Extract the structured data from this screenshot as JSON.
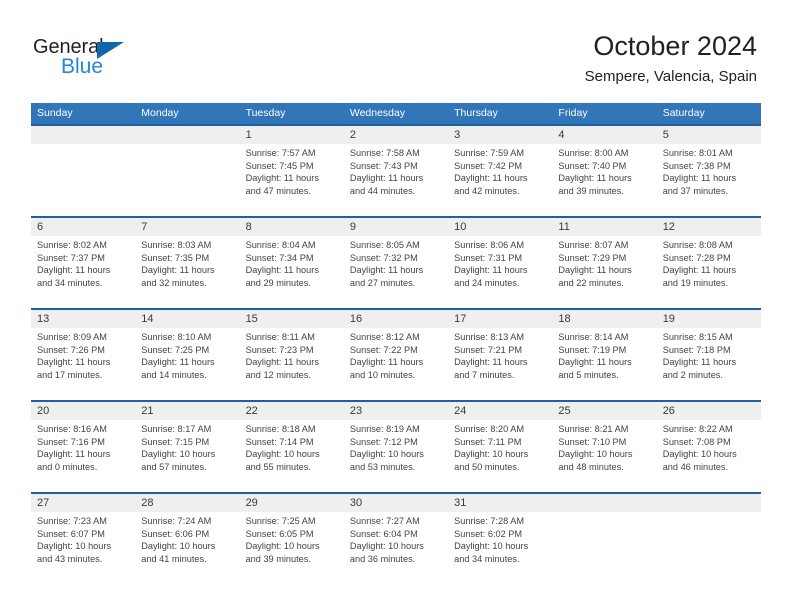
{
  "brand": {
    "name_part1": "General",
    "name_part2": "Blue",
    "triangle_color": "#1266ad",
    "blue_color": "#2388d6"
  },
  "header": {
    "title": "October 2024",
    "subtitle": "Sempere, Valencia, Spain",
    "weekday_header_bg": "#3176b9",
    "row_divider_color": "#21609f",
    "day_band_bg": "#efefef"
  },
  "weekdays": [
    "Sunday",
    "Monday",
    "Tuesday",
    "Wednesday",
    "Thursday",
    "Friday",
    "Saturday"
  ],
  "weeks": [
    [
      {
        "day": "",
        "sunrise": "",
        "sunset": "",
        "daylight1": "",
        "daylight2": "",
        "empty": true
      },
      {
        "day": "",
        "sunrise": "",
        "sunset": "",
        "daylight1": "",
        "daylight2": "",
        "empty": true
      },
      {
        "day": "1",
        "sunrise": "Sunrise: 7:57 AM",
        "sunset": "Sunset: 7:45 PM",
        "daylight1": "Daylight: 11 hours",
        "daylight2": "and 47 minutes."
      },
      {
        "day": "2",
        "sunrise": "Sunrise: 7:58 AM",
        "sunset": "Sunset: 7:43 PM",
        "daylight1": "Daylight: 11 hours",
        "daylight2": "and 44 minutes."
      },
      {
        "day": "3",
        "sunrise": "Sunrise: 7:59 AM",
        "sunset": "Sunset: 7:42 PM",
        "daylight1": "Daylight: 11 hours",
        "daylight2": "and 42 minutes."
      },
      {
        "day": "4",
        "sunrise": "Sunrise: 8:00 AM",
        "sunset": "Sunset: 7:40 PM",
        "daylight1": "Daylight: 11 hours",
        "daylight2": "and 39 minutes."
      },
      {
        "day": "5",
        "sunrise": "Sunrise: 8:01 AM",
        "sunset": "Sunset: 7:38 PM",
        "daylight1": "Daylight: 11 hours",
        "daylight2": "and 37 minutes."
      }
    ],
    [
      {
        "day": "6",
        "sunrise": "Sunrise: 8:02 AM",
        "sunset": "Sunset: 7:37 PM",
        "daylight1": "Daylight: 11 hours",
        "daylight2": "and 34 minutes."
      },
      {
        "day": "7",
        "sunrise": "Sunrise: 8:03 AM",
        "sunset": "Sunset: 7:35 PM",
        "daylight1": "Daylight: 11 hours",
        "daylight2": "and 32 minutes."
      },
      {
        "day": "8",
        "sunrise": "Sunrise: 8:04 AM",
        "sunset": "Sunset: 7:34 PM",
        "daylight1": "Daylight: 11 hours",
        "daylight2": "and 29 minutes."
      },
      {
        "day": "9",
        "sunrise": "Sunrise: 8:05 AM",
        "sunset": "Sunset: 7:32 PM",
        "daylight1": "Daylight: 11 hours",
        "daylight2": "and 27 minutes."
      },
      {
        "day": "10",
        "sunrise": "Sunrise: 8:06 AM",
        "sunset": "Sunset: 7:31 PM",
        "daylight1": "Daylight: 11 hours",
        "daylight2": "and 24 minutes."
      },
      {
        "day": "11",
        "sunrise": "Sunrise: 8:07 AM",
        "sunset": "Sunset: 7:29 PM",
        "daylight1": "Daylight: 11 hours",
        "daylight2": "and 22 minutes."
      },
      {
        "day": "12",
        "sunrise": "Sunrise: 8:08 AM",
        "sunset": "Sunset: 7:28 PM",
        "daylight1": "Daylight: 11 hours",
        "daylight2": "and 19 minutes."
      }
    ],
    [
      {
        "day": "13",
        "sunrise": "Sunrise: 8:09 AM",
        "sunset": "Sunset: 7:26 PM",
        "daylight1": "Daylight: 11 hours",
        "daylight2": "and 17 minutes."
      },
      {
        "day": "14",
        "sunrise": "Sunrise: 8:10 AM",
        "sunset": "Sunset: 7:25 PM",
        "daylight1": "Daylight: 11 hours",
        "daylight2": "and 14 minutes."
      },
      {
        "day": "15",
        "sunrise": "Sunrise: 8:11 AM",
        "sunset": "Sunset: 7:23 PM",
        "daylight1": "Daylight: 11 hours",
        "daylight2": "and 12 minutes."
      },
      {
        "day": "16",
        "sunrise": "Sunrise: 8:12 AM",
        "sunset": "Sunset: 7:22 PM",
        "daylight1": "Daylight: 11 hours",
        "daylight2": "and 10 minutes."
      },
      {
        "day": "17",
        "sunrise": "Sunrise: 8:13 AM",
        "sunset": "Sunset: 7:21 PM",
        "daylight1": "Daylight: 11 hours",
        "daylight2": "and 7 minutes."
      },
      {
        "day": "18",
        "sunrise": "Sunrise: 8:14 AM",
        "sunset": "Sunset: 7:19 PM",
        "daylight1": "Daylight: 11 hours",
        "daylight2": "and 5 minutes."
      },
      {
        "day": "19",
        "sunrise": "Sunrise: 8:15 AM",
        "sunset": "Sunset: 7:18 PM",
        "daylight1": "Daylight: 11 hours",
        "daylight2": "and 2 minutes."
      }
    ],
    [
      {
        "day": "20",
        "sunrise": "Sunrise: 8:16 AM",
        "sunset": "Sunset: 7:16 PM",
        "daylight1": "Daylight: 11 hours",
        "daylight2": "and 0 minutes."
      },
      {
        "day": "21",
        "sunrise": "Sunrise: 8:17 AM",
        "sunset": "Sunset: 7:15 PM",
        "daylight1": "Daylight: 10 hours",
        "daylight2": "and 57 minutes."
      },
      {
        "day": "22",
        "sunrise": "Sunrise: 8:18 AM",
        "sunset": "Sunset: 7:14 PM",
        "daylight1": "Daylight: 10 hours",
        "daylight2": "and 55 minutes."
      },
      {
        "day": "23",
        "sunrise": "Sunrise: 8:19 AM",
        "sunset": "Sunset: 7:12 PM",
        "daylight1": "Daylight: 10 hours",
        "daylight2": "and 53 minutes."
      },
      {
        "day": "24",
        "sunrise": "Sunrise: 8:20 AM",
        "sunset": "Sunset: 7:11 PM",
        "daylight1": "Daylight: 10 hours",
        "daylight2": "and 50 minutes."
      },
      {
        "day": "25",
        "sunrise": "Sunrise: 8:21 AM",
        "sunset": "Sunset: 7:10 PM",
        "daylight1": "Daylight: 10 hours",
        "daylight2": "and 48 minutes."
      },
      {
        "day": "26",
        "sunrise": "Sunrise: 8:22 AM",
        "sunset": "Sunset: 7:08 PM",
        "daylight1": "Daylight: 10 hours",
        "daylight2": "and 46 minutes."
      }
    ],
    [
      {
        "day": "27",
        "sunrise": "Sunrise: 7:23 AM",
        "sunset": "Sunset: 6:07 PM",
        "daylight1": "Daylight: 10 hours",
        "daylight2": "and 43 minutes."
      },
      {
        "day": "28",
        "sunrise": "Sunrise: 7:24 AM",
        "sunset": "Sunset: 6:06 PM",
        "daylight1": "Daylight: 10 hours",
        "daylight2": "and 41 minutes."
      },
      {
        "day": "29",
        "sunrise": "Sunrise: 7:25 AM",
        "sunset": "Sunset: 6:05 PM",
        "daylight1": "Daylight: 10 hours",
        "daylight2": "and 39 minutes."
      },
      {
        "day": "30",
        "sunrise": "Sunrise: 7:27 AM",
        "sunset": "Sunset: 6:04 PM",
        "daylight1": "Daylight: 10 hours",
        "daylight2": "and 36 minutes."
      },
      {
        "day": "31",
        "sunrise": "Sunrise: 7:28 AM",
        "sunset": "Sunset: 6:02 PM",
        "daylight1": "Daylight: 10 hours",
        "daylight2": "and 34 minutes."
      },
      {
        "day": "",
        "sunrise": "",
        "sunset": "",
        "daylight1": "",
        "daylight2": "",
        "empty": true
      },
      {
        "day": "",
        "sunrise": "",
        "sunset": "",
        "daylight1": "",
        "daylight2": "",
        "empty": true
      }
    ]
  ]
}
